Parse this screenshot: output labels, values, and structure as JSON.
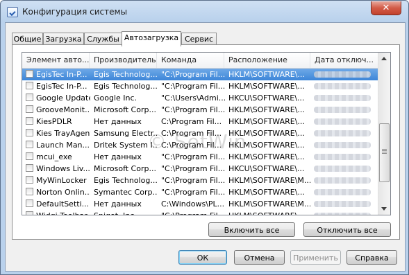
{
  "window": {
    "title": "Конфигурация системы",
    "close_glyph": "✕"
  },
  "tabs": [
    {
      "label": "Общие"
    },
    {
      "label": "Загрузка"
    },
    {
      "label": "Службы"
    },
    {
      "label": "Автозагрузка",
      "active": true
    },
    {
      "label": "Сервис"
    }
  ],
  "columns": [
    "Элемент авто...",
    "Производитель",
    "Команда",
    "Расположение",
    "Дата отключ..."
  ],
  "rows": [
    {
      "item": "EgisTec In-P...",
      "maker": "Egis Technolog...",
      "command": "\"C:\\Program Fil...",
      "location": "HKLM\\SOFTWARE\\...",
      "selected": true
    },
    {
      "item": "EgisTec In-P...",
      "maker": "Egis Technolog...",
      "command": "\"C:\\Program Fil...",
      "location": "HKLM\\SOFTWARE\\..."
    },
    {
      "item": "Google Update",
      "maker": "Google Inc.",
      "command": "\"C:\\Users\\Admi...",
      "location": "HKCU\\SOFTWARE\\..."
    },
    {
      "item": "GrooveMonit...",
      "maker": "Microsoft Corp...",
      "command": "\"C:\\Program Fil...",
      "location": "HKLM\\SOFTWARE\\..."
    },
    {
      "item": "KiesPDLR",
      "maker": "Нет данных",
      "command": "C:\\Program Fil...",
      "location": "HKLM\\SOFTWARE\\..."
    },
    {
      "item": "Kies TrayAgent",
      "maker": "Samsung Electr...",
      "command": "C:\\Program Fil...",
      "location": "HKLM\\SOFTWARE\\..."
    },
    {
      "item": "Launch Man...",
      "maker": "Dritek System I...",
      "command": "C:\\Program Fil...",
      "location": "HKLM\\SOFTWARE\\..."
    },
    {
      "item": "mcui_exe",
      "maker": "Нет данных",
      "command": "\"C:\\Program Fil...",
      "location": "HKLM\\SOFTWARE\\..."
    },
    {
      "item": "Windows Liv...",
      "maker": "Microsoft Corp...",
      "command": "\"C:\\Program Fil...",
      "location": "HKCU\\SOFTWARE\\..."
    },
    {
      "item": "MyWinLocker",
      "maker": "Egis Technolog...",
      "command": "\"C:\\Program Fil...",
      "location": "HKLM\\SOFTWARE\\M..."
    },
    {
      "item": "Norton Onlin...",
      "maker": "Symantec Corp...",
      "command": "\"C:\\Program Fil...",
      "location": "HKLM\\SOFTWARE\\..."
    },
    {
      "item": "DefaultSetti...",
      "maker": "Нет данных",
      "command": "C:\\Windows\\PL...",
      "location": "HKLM\\SOFTWARE\\M..."
    },
    {
      "item": "Widgi Toolbar",
      "maker": "Spigot, Inc.",
      "command": "\"C:\\Program Fil...",
      "location": "HKLM\\SOFTWARE\\..."
    }
  ],
  "watermark": "© SetWin",
  "buttons": {
    "enable_all": "Включить все",
    "disable_all": "Отключить все",
    "ok": "ОК",
    "cancel": "Отмена",
    "apply": "Применить",
    "help": "Справка"
  }
}
